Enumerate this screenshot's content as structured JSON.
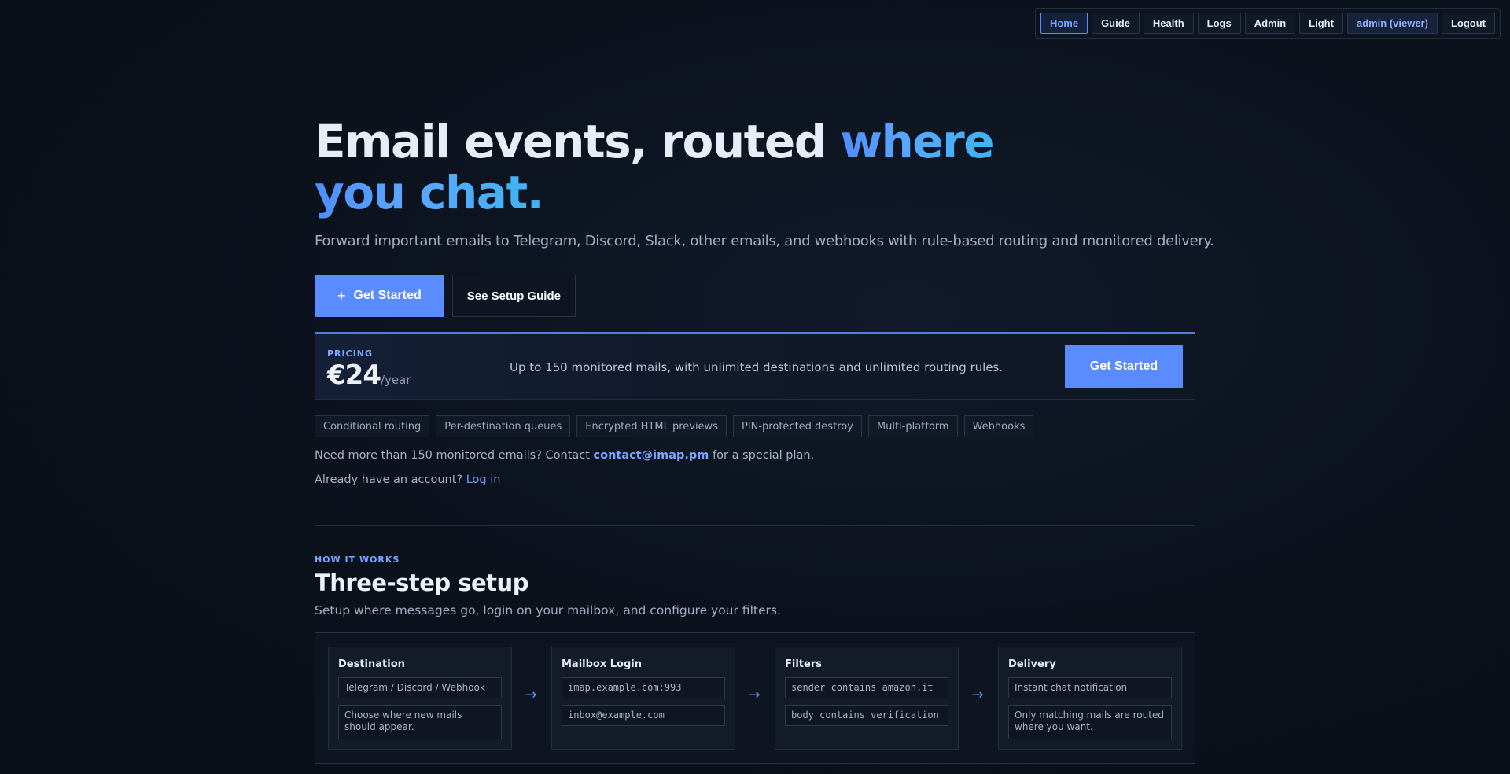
{
  "nav": {
    "home": "Home",
    "guide": "Guide",
    "health": "Health",
    "logs": "Logs",
    "admin": "Admin",
    "theme": "Light",
    "user": "admin (viewer)",
    "logout": "Logout"
  },
  "hero": {
    "title_plain": "Email events, routed ",
    "title_accent_1": "where",
    "title_accent_2": "you chat.",
    "subtitle": "Forward important emails to Telegram, Discord, Slack, other emails, and webhooks with rule-based routing and monitored delivery.",
    "primary_cta": "Get Started",
    "primary_cta_icon": "+",
    "secondary_cta": "See Setup Guide"
  },
  "pricing": {
    "label": "PRICING",
    "price": "€24",
    "unit": "/year",
    "description": "Up to 150 monitored mails, with unlimited destinations and unlimited routing rules.",
    "cta": "Get Started"
  },
  "features": [
    "Conditional routing",
    "Per-destination queues",
    "Encrypted HTML previews",
    "PIN-protected destroy",
    "Multi-platform",
    "Webhooks"
  ],
  "contact": {
    "before": "Need more than 150 monitored emails? Contact ",
    "email": "contact@imap.pm",
    "after": " for a special plan."
  },
  "login": {
    "before": "Already have an account? ",
    "link": "Log in"
  },
  "how": {
    "eyebrow": "HOW IT WORKS",
    "title": "Three-step setup",
    "subtitle": "Setup where messages go, login on your mailbox, and configure your filters."
  },
  "steps": [
    {
      "title": "Destination",
      "field1": "Telegram / Discord / Webhook",
      "field2": "Choose where new mails should appear."
    },
    {
      "title": "Mailbox Login",
      "field1": "imap.example.com:993",
      "field2": "inbox@example.com"
    },
    {
      "title": "Filters",
      "field1": "sender contains amazon.it",
      "field2": "body contains verification"
    },
    {
      "title": "Delivery",
      "field1": "Instant chat notification",
      "field2": "Only matching mails are routed where you want."
    }
  ],
  "arrow": "→",
  "colors": {
    "accent": "#5a8cff",
    "background": "#0b111b"
  }
}
